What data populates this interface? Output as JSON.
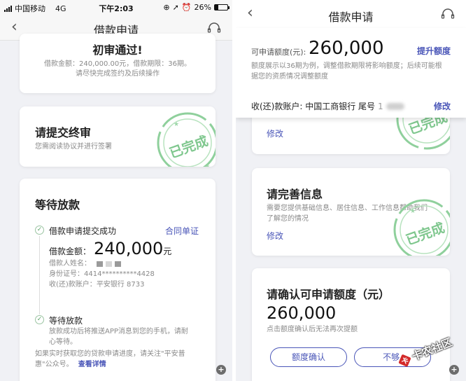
{
  "left": {
    "status": {
      "carrier": "中国移动",
      "network": "4G",
      "time": "下午2:03",
      "battery": "26%",
      "battery_level": 0.26
    },
    "nav": {
      "title": "借款申请"
    },
    "card1": {
      "title": "初审通过!",
      "line1": "借款金额：240,000.00元，借款期限：36期。",
      "line2": "请尽快完成签约及后续操作"
    },
    "card2": {
      "title": "请提交终审",
      "desc": "您需阅读协议并进行签署",
      "stamp": "已完成"
    },
    "card3": {
      "title": "等待放款",
      "step1": {
        "title": "借款申请提交成功",
        "link": "合同单证",
        "amount_label": "借款金额：",
        "amount_value": "240,000",
        "amount_unit": "元",
        "name_label": "借款人姓名：",
        "id_label": "身份证号：",
        "id_value": "4414**********4428",
        "account_label": "收(还)款账户：",
        "account_value": "平安银行 8733"
      },
      "step2": {
        "title": "等待放款",
        "desc1": "放款成功后将推送APP消息到您的手机，请耐",
        "desc2": "心等待。"
      },
      "note1": "如果实时获取您的贷款申请进度，请关注\"平安普",
      "note2": "惠\"公众号。",
      "note_link": "查看详情"
    }
  },
  "right": {
    "nav": {
      "title": "借款申请"
    },
    "quota": {
      "label": "可申请额度(元):",
      "value": "260,000",
      "raise": "提升额度",
      "desc1": "额度展示以36期为例，调整借款期限将影响额度；后续可能根",
      "desc2": "据您的资质情况调整额度",
      "account_label": "收(还)款账户: 中国工商银行 尾号",
      "account_tail": "1",
      "modify": "修改"
    },
    "card_partial": {
      "modify": "修改",
      "stamp": "已完成"
    },
    "card_info": {
      "title": "请完善信息",
      "desc1": "需要您提供基础信息、居住信息、工作信息帮助我们",
      "desc2": "了解您的情况",
      "modify": "修改",
      "stamp": "已完成"
    },
    "card_confirm": {
      "title": "请确认可申请额度（元）",
      "value": "260,000",
      "desc": "点击额度确认后无法再次提额",
      "confirm_btn": "额度确认",
      "reject_btn": "不够,"
    },
    "watermark": "卡农社区"
  },
  "colors": {
    "accent": "#4a56b8",
    "stamp": "#5fb573",
    "text": "#222222",
    "muted": "#8a8a8a"
  }
}
